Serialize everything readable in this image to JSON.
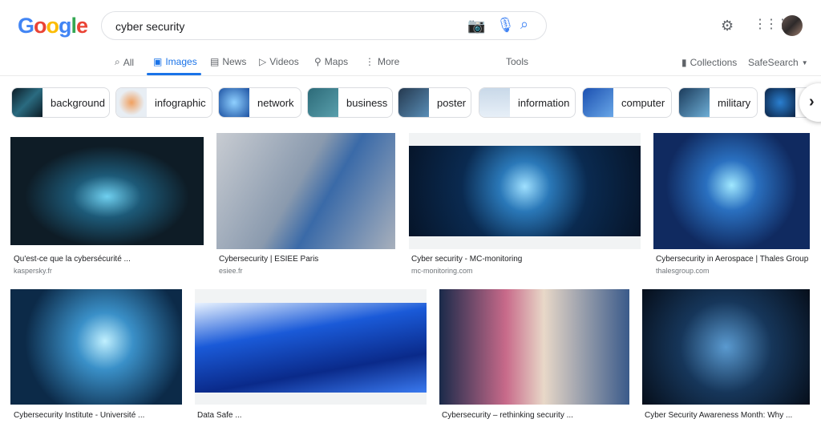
{
  "header": {
    "logo": "Google",
    "query": "cyber security"
  },
  "tabs": [
    {
      "label": "All",
      "icon": "search-icon"
    },
    {
      "label": "Images",
      "icon": "image-icon"
    },
    {
      "label": "News",
      "icon": "news-icon"
    },
    {
      "label": "Videos",
      "icon": "video-icon"
    },
    {
      "label": "Maps",
      "icon": "map-pin-icon"
    },
    {
      "label": "More",
      "icon": "more-icon"
    }
  ],
  "tools": "Tools",
  "collections": "Collections",
  "safesearch": "SafeSearch",
  "chips": [
    "background",
    "infographic",
    "network",
    "business",
    "poster",
    "information",
    "computer",
    "military",
    ""
  ],
  "results": [
    {
      "title": "Qu'est-ce que la cybersécurité ...",
      "source": "kaspersky.fr"
    },
    {
      "title": "Cybersecurity | ESIEE Paris",
      "source": "esiee.fr"
    },
    {
      "title": "Cyber security - MC-monitoring",
      "source": "mc-monitoring.com"
    },
    {
      "title": "Cybersecurity in Aerospace | Thales Group",
      "source": "thalesgroup.com"
    },
    {
      "title": "Cybersecurity Institute - Université ...",
      "source": ""
    },
    {
      "title": "Data Safe ...",
      "source": ""
    },
    {
      "title": "Cybersecurity – rethinking security ...",
      "source": ""
    },
    {
      "title": "Cyber Security Awareness Month: Why ...",
      "source": ""
    }
  ],
  "colors": {
    "accent": "#1a73e8"
  }
}
